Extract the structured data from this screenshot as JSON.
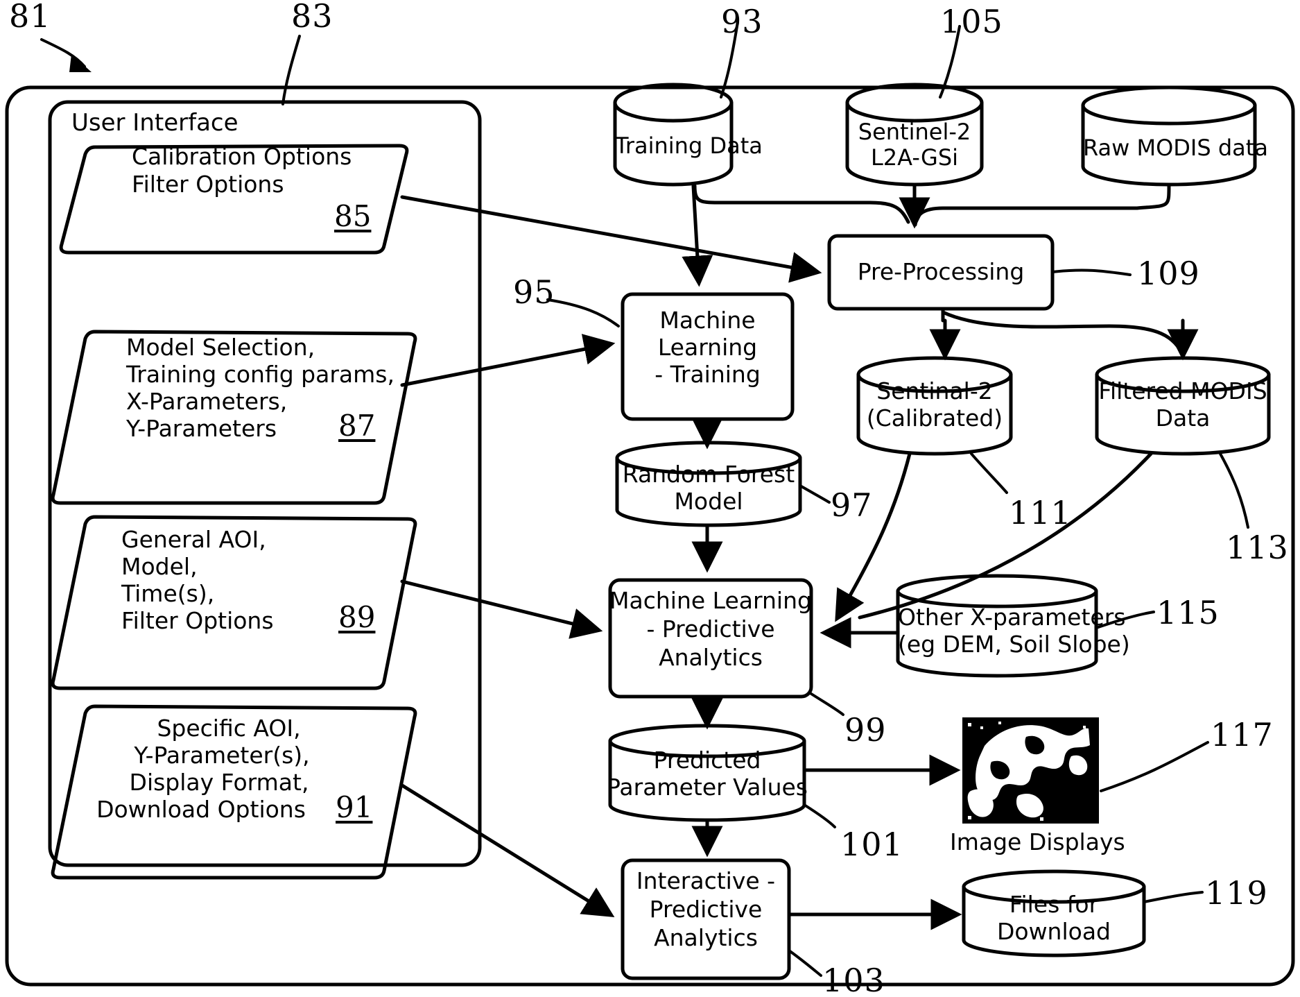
{
  "figure": {
    "type": "patent-flow-diagram",
    "system_ref": "81",
    "ui_panel_ref": "83",
    "ui_panel_title": "User Interface"
  },
  "ui_inputs": [
    {
      "ref": "85",
      "lines": [
        "Calibration Options",
        "Filter Options"
      ],
      "name": "calibration-filter-options"
    },
    {
      "ref": "87",
      "lines": [
        "Model Selection,",
        "Training config params,",
        "X-Parameters,",
        "Y-Parameters"
      ],
      "name": "model-selection-params"
    },
    {
      "ref": "89",
      "lines": [
        "General AOI,",
        "Model,",
        "Time(s),",
        "Filter Options"
      ],
      "name": "general-aoi-options"
    },
    {
      "ref": "91",
      "lines": [
        "Specific AOI,",
        "Y-Parameter(s),",
        "Display Format,",
        "Download Options"
      ],
      "name": "specific-aoi-options"
    }
  ],
  "data_stores": {
    "training_data": {
      "ref": "93",
      "lines": [
        "Training Data"
      ]
    },
    "sentinel2_l2a": {
      "ref": "105",
      "lines": [
        "Sentinel-2",
        "L2A-GSi"
      ]
    },
    "raw_modis": {
      "ref": "",
      "lines": [
        "Raw MODIS data"
      ]
    },
    "sentinal2_calibrated": {
      "ref": "111",
      "lines": [
        "Sentinal-2",
        "(Calibrated)"
      ]
    },
    "filtered_modis": {
      "ref": "113",
      "lines": [
        "Filtered MODIS",
        "Data"
      ]
    },
    "random_forest_model": {
      "ref": "97",
      "lines": [
        "Random Forest",
        "Model"
      ]
    },
    "other_x_parameters": {
      "ref": "115",
      "lines": [
        "Other X-parameters",
        "(eg DEM, Soil Slope)"
      ]
    },
    "predicted_parameter_values": {
      "ref": "101",
      "lines": [
        "Predicted",
        "Parameter Values"
      ]
    },
    "files_for_download": {
      "ref": "119",
      "lines": [
        "Files for",
        "Download"
      ]
    }
  },
  "processes": {
    "pre_processing": {
      "ref": "109",
      "lines": [
        "Pre-Processing"
      ]
    },
    "ml_training": {
      "ref": "95",
      "lines": [
        "Machine",
        "Learning",
        "- Training"
      ]
    },
    "ml_predictive": {
      "ref": "99",
      "lines": [
        "Machine Learning",
        "- Predictive",
        "Analytics"
      ]
    },
    "interactive_predictive": {
      "ref": "103",
      "lines": [
        "Interactive -",
        "Predictive",
        "Analytics"
      ]
    }
  },
  "outputs": {
    "image_displays": {
      "ref": "117",
      "caption": "Image Displays"
    }
  },
  "colors": {
    "stroke": "#000000",
    "background": "#ffffff",
    "thumbnail_dark": "#000000",
    "thumbnail_light": "#ffffff"
  }
}
